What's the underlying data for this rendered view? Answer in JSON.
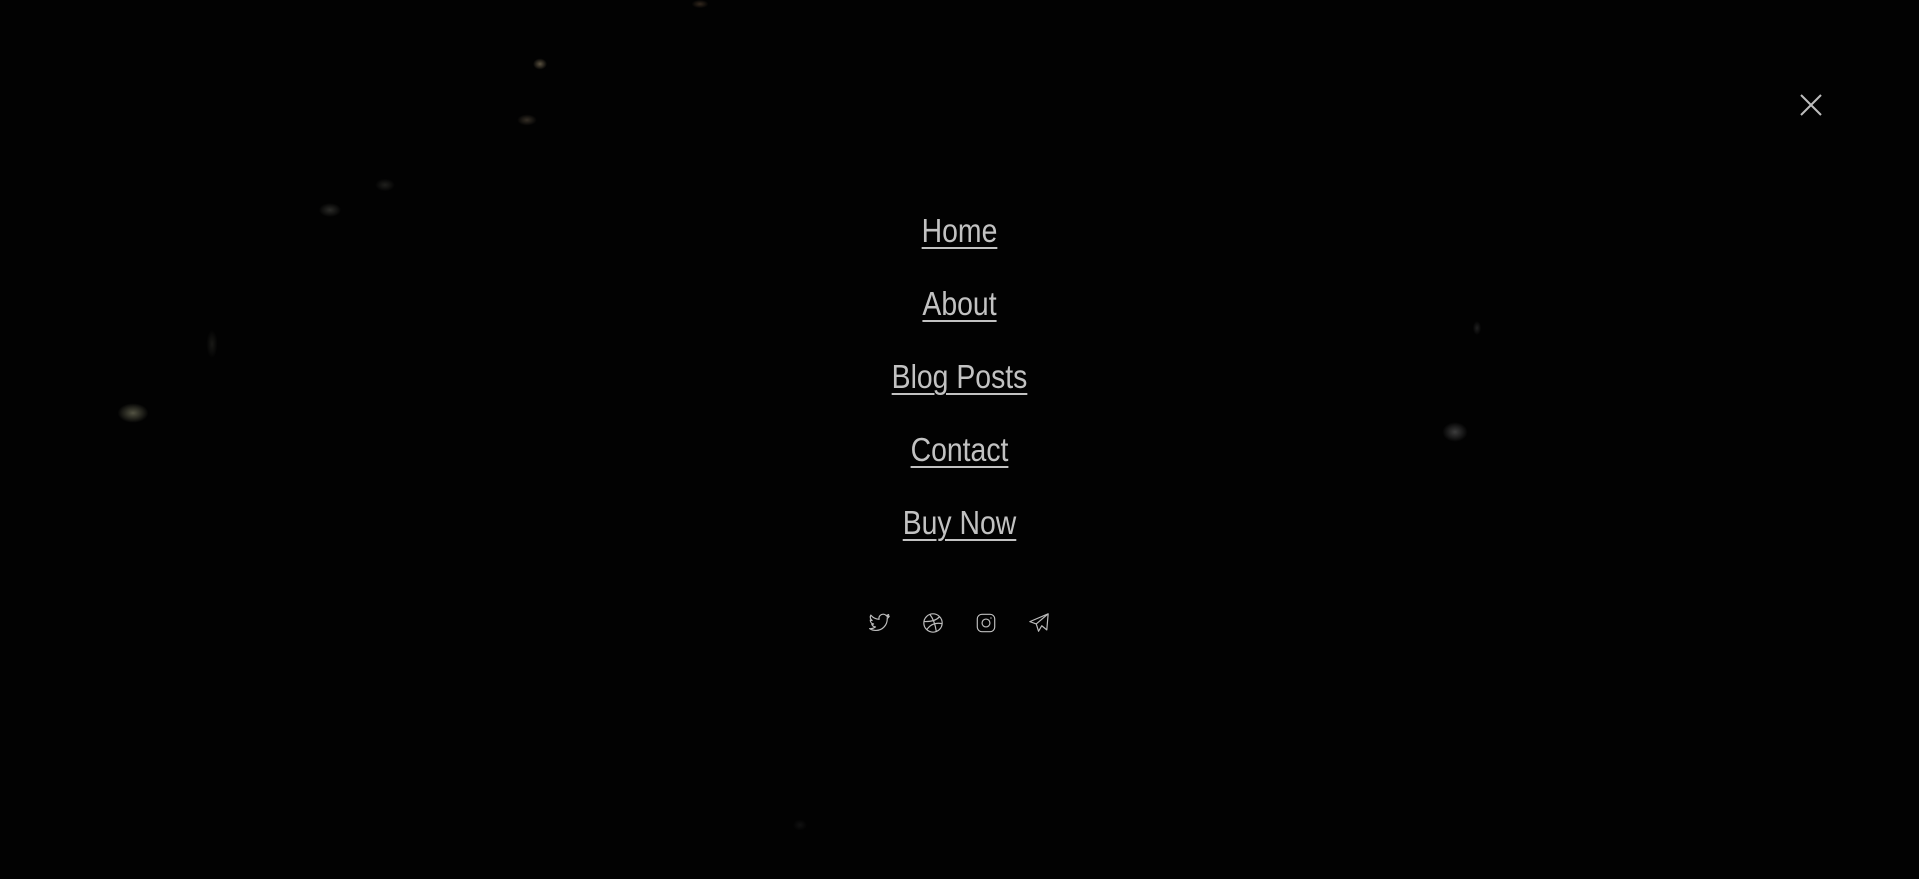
{
  "menu": {
    "items": [
      {
        "label": "Home"
      },
      {
        "label": "About"
      },
      {
        "label": "Blog Posts"
      },
      {
        "label": "Contact"
      },
      {
        "label": "Buy Now"
      }
    ]
  },
  "social": {
    "icons": [
      "twitter-icon",
      "dribbble-icon",
      "instagram-icon",
      "telegram-icon"
    ]
  },
  "close": {
    "icon": "close-icon"
  },
  "colors": {
    "background": "#020202",
    "text": "#c2c2c2",
    "icon": "#bdbdbd"
  }
}
